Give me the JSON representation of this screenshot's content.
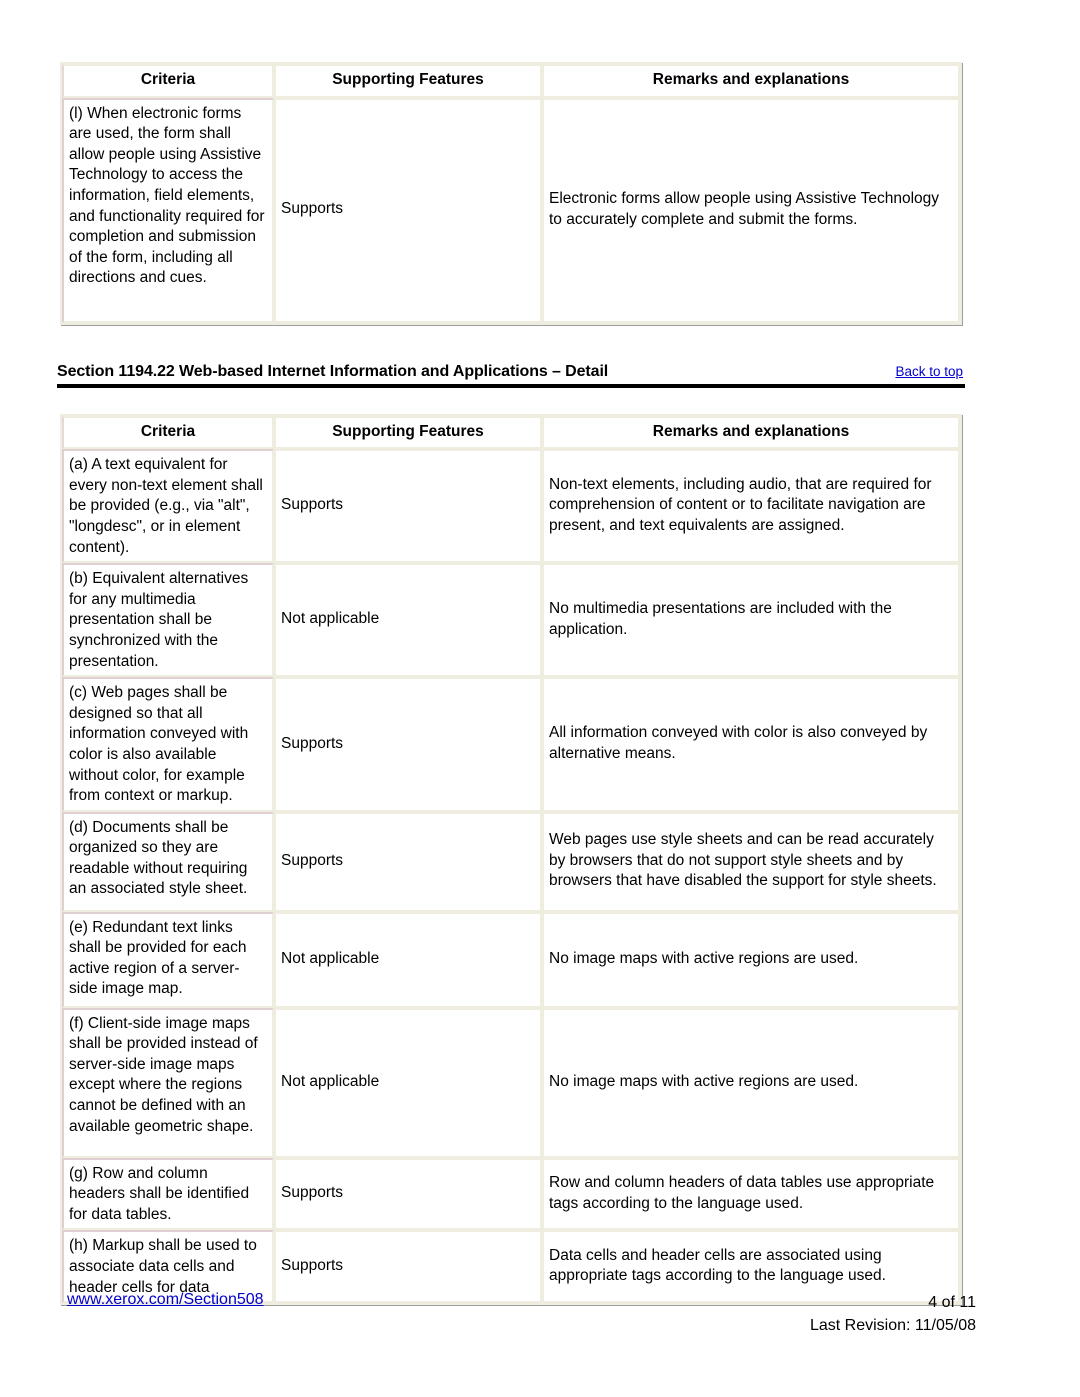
{
  "document": {
    "columns": [
      "Criteria",
      "Supporting Features",
      "Remarks and explanations"
    ]
  },
  "table_top": {
    "headers": {
      "criteria": "Criteria",
      "supporting_features": "Supporting Features",
      "remarks": "Remarks and explanations"
    },
    "rows": [
      {
        "criteria": "(l) When electronic forms are used, the form shall allow people using Assistive Technology to access the information, field elements, and functionality required for completion and submission of the form, including all directions and cues.",
        "support": "Supports",
        "remarks": "Electronic forms allow people using Assistive Technology to accurately complete and submit the forms."
      }
    ]
  },
  "section": {
    "title": "Section 1194.22 Web-based Internet Information and Applications – Detail",
    "back_to_top": "Back to top"
  },
  "table_detail": {
    "headers": {
      "criteria": "Criteria",
      "supporting_features": "Supporting Features",
      "remarks": "Remarks and explanations"
    },
    "rows": [
      {
        "criteria": "(a) A text equivalent for every non-text element shall be provided (e.g., via \"alt\", \"longdesc\", or in element content).",
        "support": "Supports",
        "remarks": "Non-text elements, including audio, that are required for comprehension of content or to facilitate navigation are present, and text equivalents are assigned."
      },
      {
        "criteria": "(b) Equivalent alternatives for any multimedia presentation shall be synchronized with the presentation.",
        "support": "Not applicable",
        "remarks": "No multimedia presentations are included with the application."
      },
      {
        "criteria": "(c) Web pages shall be designed so that all information conveyed with color is also available without color, for example from context or markup.",
        "support": "Supports",
        "remarks": "All information conveyed with color is also conveyed by alternative means."
      },
      {
        "criteria": "(d) Documents shall be organized so they are readable without requiring an associated style sheet.",
        "support": "Supports",
        "remarks": "Web pages use style sheets and can be read accurately by browsers that do not support style sheets and by browsers that have disabled the support for style sheets."
      },
      {
        "criteria": "(e) Redundant text links shall be provided for each active region of a server-side image map.",
        "support": "Not applicable",
        "remarks": "No image maps with active regions are used."
      },
      {
        "criteria": "(f) Client-side image maps shall be provided instead of server-side image maps except where the regions cannot be defined with an available geometric shape.",
        "support": "Not applicable",
        "remarks": "No image maps with active regions are used."
      },
      {
        "criteria": "(g) Row and column headers shall be identified for data tables.",
        "support": "Supports",
        "remarks": "Row and column headers of data tables use appropriate tags according to the language used."
      },
      {
        "criteria": "(h) Markup shall be used to associate data cells and header cells for data",
        "support": "Supports",
        "remarks": "Data cells and header cells are associated using appropriate tags according to the language used."
      }
    ]
  },
  "footer": {
    "url": "www.xerox.com/Section508",
    "page_number": "4 of 11",
    "revision": "Last Revision: 11/05/08"
  },
  "colors": {
    "link": "#0000cc",
    "table_border": "#efece0",
    "rule": "#000000"
  }
}
